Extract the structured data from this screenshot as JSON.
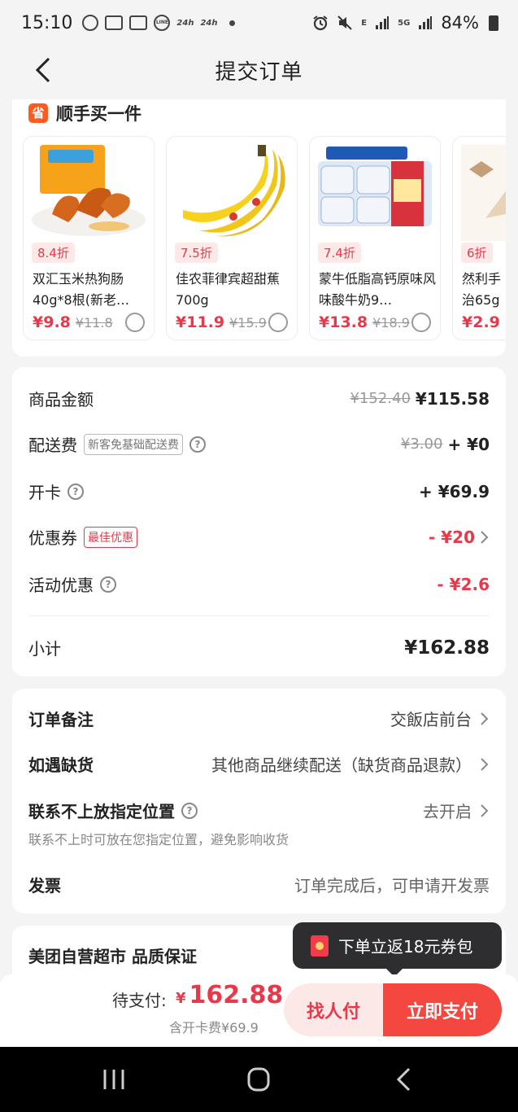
{
  "status_bar": {
    "time": "15:10",
    "battery": "84%",
    "icons": [
      "chat-icon",
      "messenger-icon",
      "messenger-icon",
      "line-icon",
      "24h-icon",
      "24h-icon",
      "alarm-icon",
      "mute-icon",
      "signal-icon",
      "5g-icon",
      "signal-icon",
      "battery-icon"
    ],
    "small_1": "24h",
    "small_2": "24h",
    "net_1": "E",
    "net_2": "5G",
    "line": "LINE"
  },
  "header": {
    "title": "提交订单"
  },
  "addon": {
    "badge": "省",
    "title": "顺手买一件",
    "products": [
      {
        "discount": "8.4折",
        "name": "双汇玉米热狗肠40g*8根(新老…",
        "price": "¥9.8",
        "original": "¥11.8"
      },
      {
        "discount": "7.5折",
        "name": "佳农菲律宾超甜蕉700g",
        "price": "¥11.9",
        "original": "¥15.9"
      },
      {
        "discount": "7.4折",
        "name": "蒙牛低脂高钙原味风味酸牛奶9…",
        "price": "¥13.8",
        "original": "¥18.9"
      },
      {
        "discount": "6折",
        "name": "然利手治65g",
        "price": "¥2.9",
        "original": ""
      }
    ]
  },
  "summary": {
    "goods_label": "商品金额",
    "goods_original": "¥152.40",
    "goods_value": "¥115.58",
    "delivery_label": "配送费",
    "delivery_tag": "新客免基础配送费",
    "delivery_original": "¥3.00",
    "delivery_value": "+ ¥0",
    "card_label": "开卡",
    "card_value": "+ ¥69.9",
    "coupon_label": "优惠券",
    "coupon_tag": "最佳优惠",
    "coupon_value": "- ¥20",
    "promo_label": "活动优惠",
    "promo_value": "- ¥2.6",
    "subtotal_label": "小计",
    "subtotal_value": "¥162.88",
    "help_glyph": "?"
  },
  "notes": {
    "remark_label": "订单备注",
    "remark_value": "交飯店前台",
    "stockout_label": "如遇缺货",
    "stockout_value": "其他商品继续配送（缺货商品退款）",
    "contact_label": "联系不上放指定位置",
    "contact_value": "去开启",
    "contact_hint": "联系不上时可放在您指定位置，避免影响收货",
    "invoice_label": "发票",
    "invoice_value": "订单完成后，可申请开发票"
  },
  "quality": {
    "title": "美团自营超市 品质保证"
  },
  "tooltip": {
    "text": "下单立返18元券包"
  },
  "bottom": {
    "pay_label": "待支付:",
    "currency": "¥",
    "amount": "162.88",
    "sub": "含开卡费¥69.9",
    "find_btn": "找人付",
    "pay_btn": "立即支付"
  },
  "colors": {
    "accent": "#e8394a",
    "pay_button": "#f4473f",
    "badge": "#ff5a1f"
  }
}
